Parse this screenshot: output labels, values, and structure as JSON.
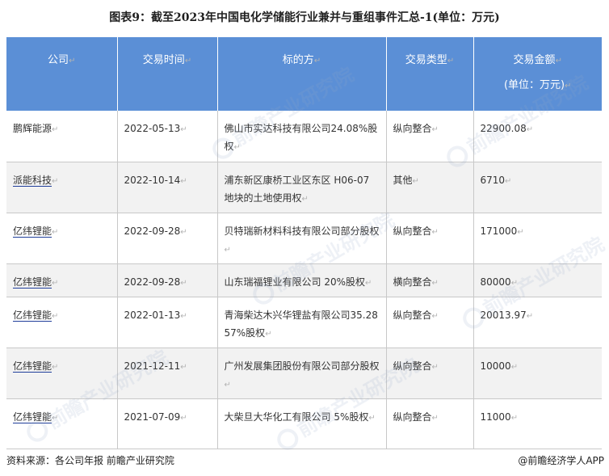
{
  "title": "图表9：截至2023年中国电化学储能行业兼并与重组事件汇总-1(单位：万元)",
  "mark": "↵",
  "headers": {
    "company": "公司",
    "date": "交易时间",
    "target": "标的方",
    "type": "交易类型",
    "amount": "交易金额",
    "amount_unit": "(单位：万元)"
  },
  "rows": [
    {
      "company": "鹏辉能源",
      "date": "2022-05-13",
      "target": "佛山市实达科技有限公司24.08%股权",
      "type": "纵向整合",
      "amount": "22900.08"
    },
    {
      "company": "派能科技",
      "date": "2022-10-14",
      "target": "浦东新区康桥工业区东区 H06-07 地块的土地使用权",
      "type": "其他",
      "amount": "6710"
    },
    {
      "company": "亿纬锂能",
      "date": "2022-09-28",
      "target": "贝特瑞新材料科技有限公司部分股权",
      "type": "纵向整合",
      "amount": "171000"
    },
    {
      "company": "亿纬锂能",
      "date": "2022-09-28",
      "target": "山东瑞福锂业有限公司 20%股权",
      "type": "横向整合",
      "amount": "80000"
    },
    {
      "company": "亿纬锂能",
      "date": "2022-01-13",
      "target": "青海柴达木兴华锂盐有限公司35.2857%股权",
      "type": "纵向整合",
      "amount": "20013.97"
    },
    {
      "company": "亿纬锂能",
      "date": "2021-12-11",
      "target": "广州发展集团股份有限公司部分股权",
      "type": "纵向整合",
      "amount": "10000"
    },
    {
      "company": "亿纬锂能",
      "date": "2021-07-09",
      "target": "大柴旦大华化工有限公司 5%股权",
      "type": "纵向整合",
      "amount": "11000"
    }
  ],
  "source": "资料来源：各公司年报 前瞻产业研究院",
  "brand": "@前瞻经济学人APP",
  "watermark": "前瞻产业研究院"
}
